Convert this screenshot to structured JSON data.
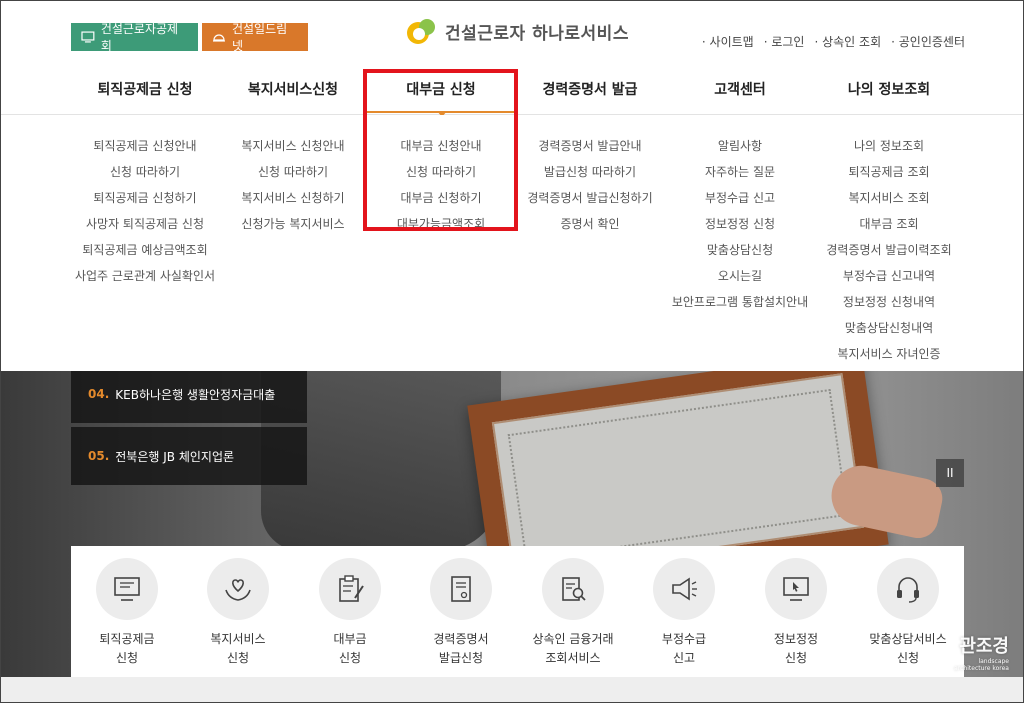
{
  "header": {
    "btn_worker": "건설근로자공제회",
    "btn_build": "건설일드림넷",
    "logo_text": "건설근로자 하나로서비스",
    "util": [
      "· 사이트맵",
      "· 로그인",
      "· 상속인 조회",
      "· 공인인증센터"
    ]
  },
  "gnb": [
    "퇴직공제금 신청",
    "복지서비스신청",
    "대부금 신청",
    "경력증명서 발급",
    "고객센터",
    "나의 정보조회"
  ],
  "menus": [
    [
      "퇴직공제금 신청안내",
      "신청 따라하기",
      "퇴직공제금 신청하기",
      "사망자 퇴직공제금 신청",
      "퇴직공제금 예상금액조회",
      "사업주 근로관계 사실확인서"
    ],
    [
      "복지서비스 신청안내",
      "신청 따라하기",
      "복지서비스 신청하기",
      "신청가능 복지서비스"
    ],
    [
      "대부금 신청안내",
      "신청 따라하기",
      "대부금 신청하기",
      "대부가능금액조회"
    ],
    [
      "경력증명서 발급안내",
      "발급신청 따라하기",
      "경력증명서 발급신청하기",
      "증명서 확인"
    ],
    [
      "알림사항",
      "자주하는 질문",
      "부정수급 신고",
      "정보정정 신청",
      "맞춤상담신청",
      "오시는길",
      "보안프로그램 통합설치안내"
    ],
    [
      "나의 정보조회",
      "퇴직공제금 조회",
      "복지서비스 조회",
      "대부금 조회",
      "경력증명서 발급이력조회",
      "부정수급 신고내역",
      "정보정정 신청내역",
      "맞춤상담신청내역",
      "복지서비스 자녀인증"
    ]
  ],
  "notices": [
    {
      "num": "04.",
      "text": "KEB하나은행 생활안정자금대출"
    },
    {
      "num": "05.",
      "text": "전북은행 JB 체인지업론"
    }
  ],
  "pause_label": "II",
  "services": [
    {
      "l1": "퇴직공제금",
      "l2": "신청"
    },
    {
      "l1": "복지서비스",
      "l2": "신청"
    },
    {
      "l1": "대부금",
      "l2": "신청"
    },
    {
      "l1": "경력증명서",
      "l2": "발급신청"
    },
    {
      "l1": "상속인 금융거래",
      "l2": "조회서비스"
    },
    {
      "l1": "부정수급",
      "l2": "신고"
    },
    {
      "l1": "정보정정",
      "l2": "신청"
    },
    {
      "l1": "맞춤상담서비스",
      "l2": "신청"
    }
  ],
  "watermark": {
    "main": "관조경",
    "sub": "landscape architecture korea"
  },
  "colors": {
    "green": "#3d9b78",
    "orange": "#d9782a",
    "accent": "#e48a2c",
    "highlight": "#e3141c"
  }
}
